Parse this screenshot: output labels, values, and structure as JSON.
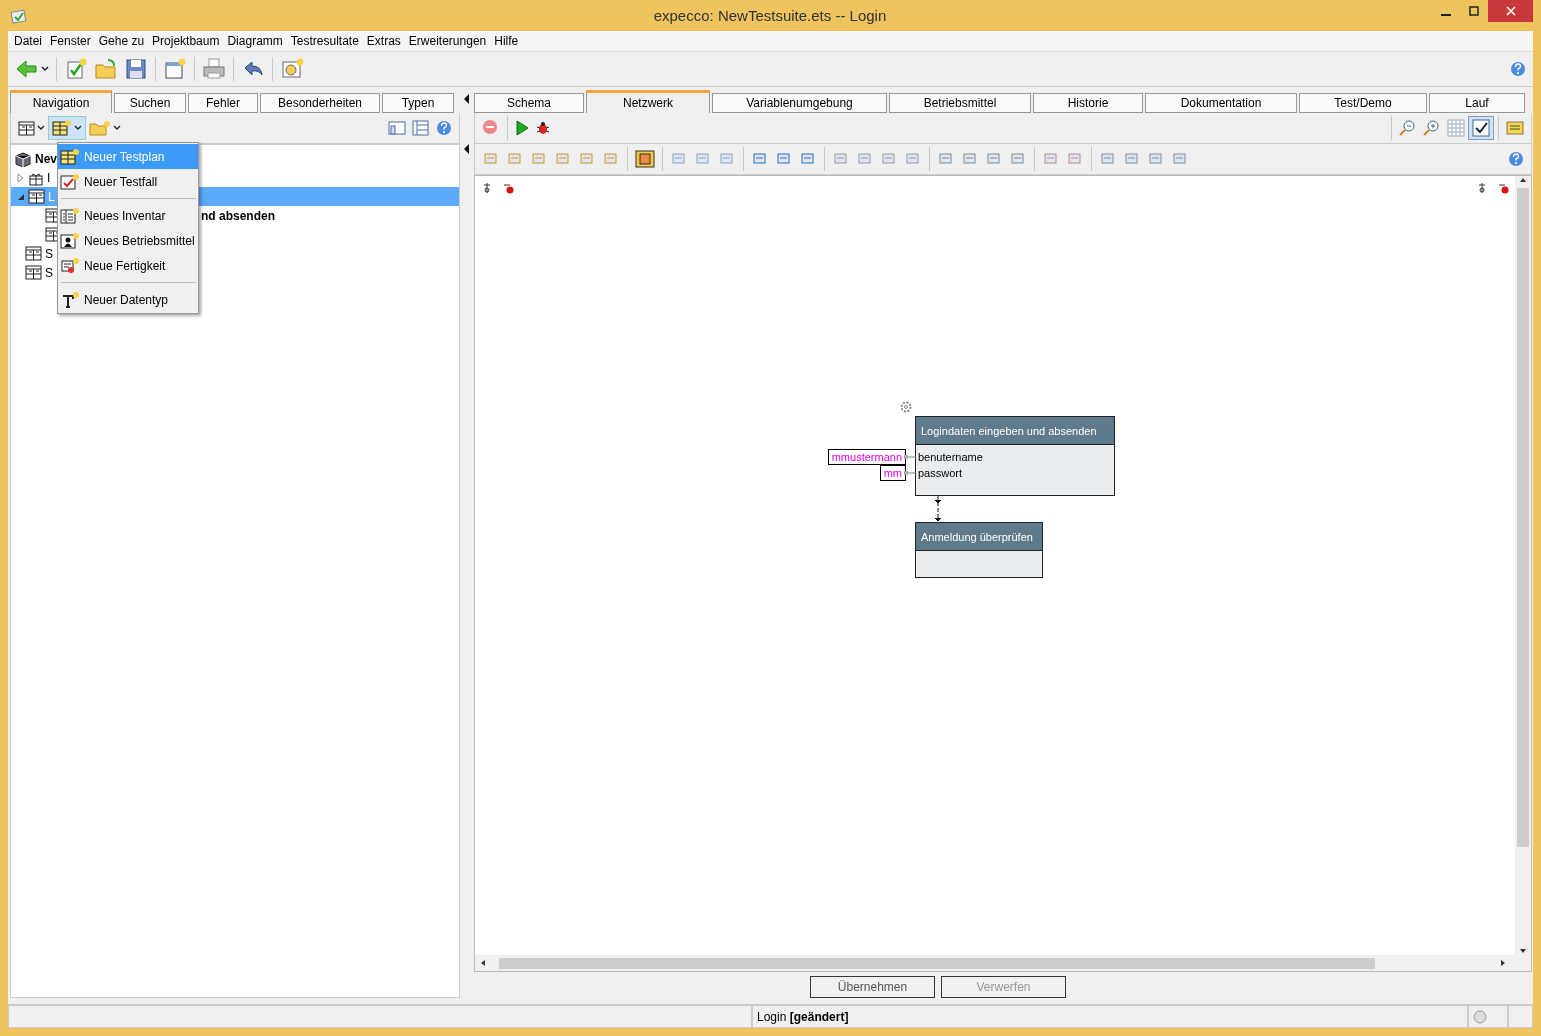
{
  "window": {
    "title": "expecco: NewTestsuite.ets -- Login"
  },
  "menu": [
    "Datei",
    "Fenster",
    "Gehe zu",
    "Projektbaum",
    "Diagramm",
    "Testresultate",
    "Extras",
    "Erweiterungen",
    "Hilfe"
  ],
  "left_tabs": [
    {
      "label": "Navigation",
      "selected": true
    },
    {
      "label": "Suchen",
      "selected": false
    },
    {
      "label": "Fehler",
      "selected": false
    },
    {
      "label": "Besonderheiten",
      "selected": false
    },
    {
      "label": "Typen",
      "selected": false
    }
  ],
  "tree": [
    {
      "label": "Nev",
      "bold": true,
      "selected": false
    },
    {
      "label": "I",
      "bold": false,
      "selected": false,
      "expanded": false
    },
    {
      "label": "L",
      "bold": false,
      "selected": true,
      "expanded": true,
      "children": [
        {
          "label": "nd absenden",
          "bold": true,
          "selected": false
        },
        {
          "selected": false
        }
      ]
    },
    {
      "label": "S",
      "bold": false,
      "selected": false
    },
    {
      "label": "S",
      "bold": false,
      "selected": false
    }
  ],
  "popup_menu": [
    {
      "label": "Neuer Testplan",
      "selected": true
    },
    {
      "label": "Neuer Testfall",
      "selected": false
    },
    {
      "kind": "separator"
    },
    {
      "label": "Neues Inventar",
      "selected": false
    },
    {
      "label": "Neues Betriebsmittel",
      "selected": false
    },
    {
      "label": "Neue Fertigkeit",
      "selected": false
    },
    {
      "kind": "separator"
    },
    {
      "label": "Neuer Datentyp",
      "selected": false
    }
  ],
  "right_tabs": [
    {
      "label": "Schema",
      "selected": false
    },
    {
      "label": "Netzwerk",
      "selected": true
    },
    {
      "label": "Variablenumgebung",
      "selected": false
    },
    {
      "label": "Betriebsmittel",
      "selected": false
    },
    {
      "label": "Historie",
      "selected": false
    },
    {
      "label": "Dokumentation",
      "selected": false
    },
    {
      "label": "Test/Demo",
      "selected": false
    },
    {
      "label": "Lauf",
      "selected": false
    }
  ],
  "diagram": {
    "steps": [
      {
        "title": "Logindaten eingeben und absenden",
        "pins": [
          {
            "name": "benutername",
            "value": "mmustermann"
          },
          {
            "name": "passwort",
            "value": "mm"
          }
        ]
      },
      {
        "title": "Anmeldung überprüfen"
      }
    ]
  },
  "buttons": [
    {
      "label": "Übernehmen",
      "disabled": false
    },
    {
      "label": "Verwerfen",
      "disabled": true
    }
  ],
  "status_bar": {
    "text": "Login **[geändert]**"
  }
}
